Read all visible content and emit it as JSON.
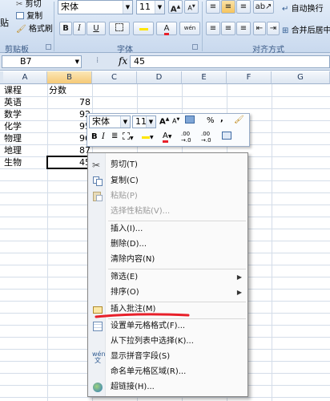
{
  "ribbon": {
    "clipboard": {
      "paste_label": "贴",
      "cut_label": "剪切",
      "copy_label": "复制",
      "format_painter_label": "格式刷",
      "group_label": "剪贴板"
    },
    "font": {
      "name": "宋体",
      "size": "11",
      "grow_label": "A",
      "shrink_label": "A",
      "bold": "B",
      "italic": "I",
      "underline": "U",
      "font_color_label": "A",
      "phonetic_label": "wén",
      "group_label": "字体"
    },
    "alignment": {
      "wrap_text_label": "自动换行",
      "merge_label": "合并后居中",
      "group_label": "对齐方式"
    }
  },
  "formula_bar": {
    "name_box": "B7",
    "fx": "fx",
    "value": "45"
  },
  "grid": {
    "columns": [
      "A",
      "B",
      "C",
      "D",
      "E",
      "F",
      "G"
    ],
    "active_column": "B",
    "rows": [
      {
        "a": "课程",
        "b": "分数"
      },
      {
        "a": "英语",
        "b": "78"
      },
      {
        "a": "数学",
        "b": "92"
      },
      {
        "a": "化学",
        "b": "95"
      },
      {
        "a": "物理",
        "b": "96"
      },
      {
        "a": "地理",
        "b": "87"
      },
      {
        "a": "生物",
        "b": "45"
      }
    ],
    "selected_cell": "B7"
  },
  "mini_toolbar": {
    "font_name": "宋体",
    "font_size": "11",
    "grow": "A",
    "shrink": "A",
    "percent": "%",
    "comma": ",",
    "bold": "B",
    "italic": "I",
    "font_color": "A",
    "inc_decimal": ".00",
    "dec_decimal": ".00"
  },
  "context_menu": {
    "items": [
      {
        "label": "剪切(T)",
        "icon": "scissors-icon",
        "enabled": true,
        "submenu": false
      },
      {
        "label": "复制(C)",
        "icon": "copy-icon",
        "enabled": true,
        "submenu": false
      },
      {
        "label": "粘贴(P)",
        "icon": "paste-icon",
        "enabled": false,
        "submenu": false
      },
      {
        "label": "选择性粘贴(V)...",
        "icon": "",
        "enabled": false,
        "submenu": false
      },
      {
        "label": "插入(I)...",
        "icon": "",
        "enabled": true,
        "submenu": false
      },
      {
        "label": "删除(D)...",
        "icon": "",
        "enabled": true,
        "submenu": false
      },
      {
        "label": "清除内容(N)",
        "icon": "",
        "enabled": true,
        "submenu": false
      },
      {
        "label": "筛选(E)",
        "icon": "",
        "enabled": true,
        "submenu": true
      },
      {
        "label": "排序(O)",
        "icon": "",
        "enabled": true,
        "submenu": true
      },
      {
        "label": "插入批注(M)",
        "icon": "comment-icon",
        "enabled": true,
        "submenu": false
      },
      {
        "label": "设置单元格格式(F)...",
        "icon": "format-cells-icon",
        "enabled": true,
        "submenu": false
      },
      {
        "label": "从下拉列表中选择(K)...",
        "icon": "",
        "enabled": true,
        "submenu": false
      },
      {
        "label": "显示拼音字段(S)",
        "icon": "phonetic-icon",
        "enabled": true,
        "submenu": false
      },
      {
        "label": "命名单元格区域(R)...",
        "icon": "",
        "enabled": true,
        "submenu": false
      },
      {
        "label": "超链接(H)...",
        "icon": "hyperlink-icon",
        "enabled": true,
        "submenu": false
      }
    ],
    "submenu_arrow": "▶"
  },
  "colors": {
    "annotation_red": "#e8202a",
    "selection_border": "#000000",
    "active_header": "#f5c977"
  }
}
